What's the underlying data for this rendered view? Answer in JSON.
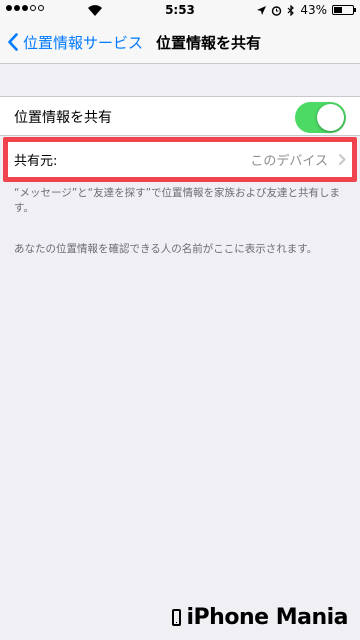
{
  "status_bar": {
    "time": "5:53",
    "battery": "43%",
    "battery_level": 0.43
  },
  "nav": {
    "back_label": "位置情報サービス",
    "title": "位置情報を共有"
  },
  "settings": {
    "share_location_label": "位置情報を共有",
    "share_location_enabled": true,
    "source_label": "共有元:",
    "source_value": "このデバイス"
  },
  "notes": {
    "sharing_note": "“メッセージ”と“友達を探す”で位置情報を家族および友達と共有します。",
    "visibility_note": "あなたの位置情報を確認できる人の名前がここに表示されます。"
  },
  "watermark": {
    "brand": "iPhone Mania"
  },
  "colors": {
    "accent": "#007aff",
    "toggle_on": "#4cd964",
    "highlight": "#f0434d",
    "background": "#efeff4"
  }
}
